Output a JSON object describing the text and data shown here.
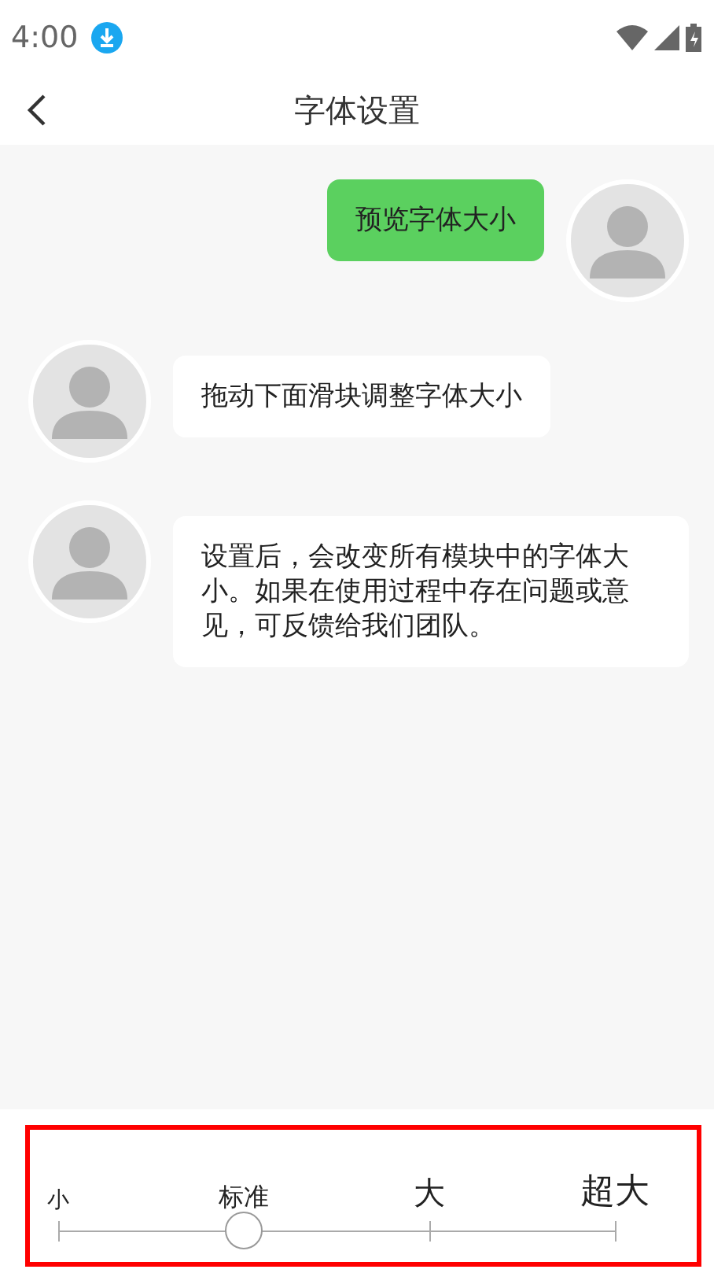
{
  "status_bar": {
    "time": "4:00"
  },
  "header": {
    "title": "字体设置"
  },
  "messages": [
    {
      "kind": "sent",
      "text": "预览字体大小"
    },
    {
      "kind": "received",
      "text": "拖动下面滑块调整字体大小"
    },
    {
      "kind": "received",
      "text": "设置后，会改变所有模块中的字体大小。如果在使用过程中存在问题或意见，可反馈给我们团队。"
    }
  ],
  "font_slider": {
    "highlighted": true,
    "level": 0.3333,
    "stops": [
      {
        "label": "小"
      },
      {
        "label": "标准"
      },
      {
        "label": "大"
      },
      {
        "label": "超大"
      }
    ]
  }
}
